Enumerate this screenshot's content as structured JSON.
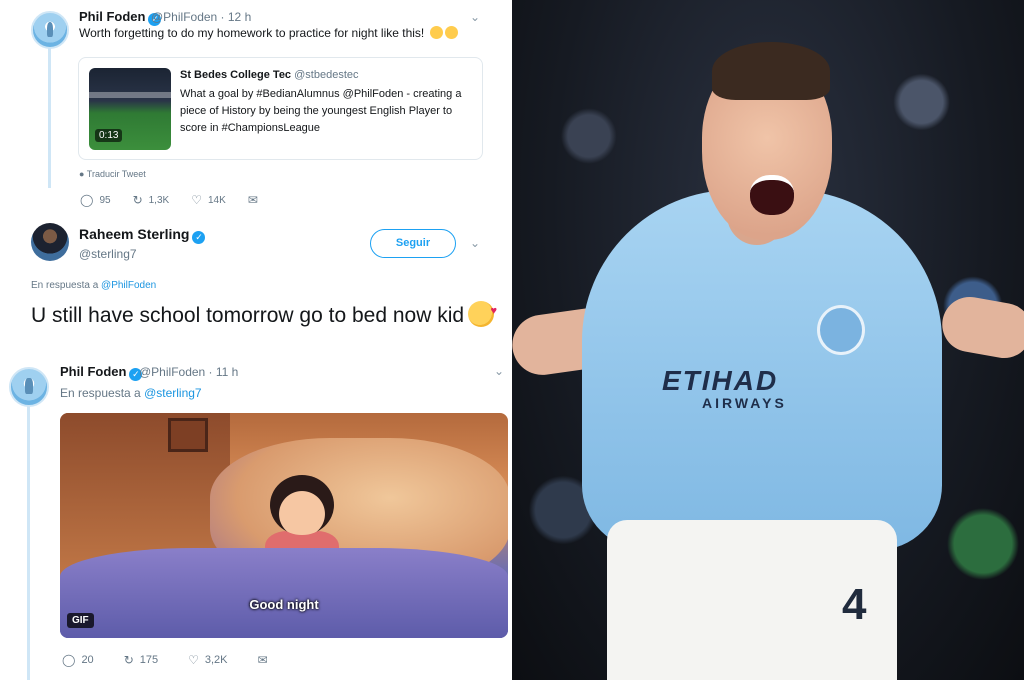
{
  "tweet1": {
    "name": "Phil Foden",
    "handle_time": "@PhilFoden · 12 h",
    "text": "Worth forgetting to do my homework to practice for night like this!",
    "quoted": {
      "name": "St Bedes College Tec",
      "handle": "@stbedestec",
      "text": "What a goal by #BedianAlumnus @PhilFoden - creating a piece of History by being the youngest English Player to score in #ChampionsLeague",
      "duration": "0:13"
    },
    "translate_label": "Traducir Tweet",
    "replies": "95",
    "retweets": "1,3K",
    "likes": "14K"
  },
  "tweet2": {
    "name": "Raheem Sterling",
    "handle": "@sterling7",
    "follow_label": "Seguir",
    "reply_prefix": "En respuesta a",
    "reply_to": "@PhilFoden",
    "text": "U still have school tomorrow go to bed now kid"
  },
  "tweet3": {
    "name": "Phil Foden",
    "handle_time": "@PhilFoden · 11 h",
    "reply_prefix": "En respuesta a",
    "reply_to": "@sterling7",
    "gif_caption": "Good night",
    "gif_badge": "GIF",
    "replies": "20",
    "retweets": "175",
    "likes": "3,2K"
  },
  "photo": {
    "sponsor": "ETIHAD",
    "sponsor_sub": "AIRWAYS",
    "shorts_number": "4"
  },
  "colors": {
    "accent": "#1da1f2",
    "muted": "#657786",
    "thread_line": "#cfe6f6"
  }
}
